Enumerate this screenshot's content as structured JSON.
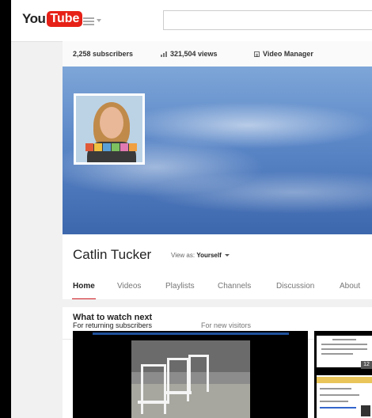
{
  "masthead": {
    "logo_you": "You",
    "logo_tube": "Tube"
  },
  "stats": {
    "subscribers": "2,258 subscribers",
    "views": "321,504 views",
    "video_manager": "Video Manager"
  },
  "channel": {
    "name": "Catlin Tucker",
    "view_as_label": "View as:",
    "view_as_value": "Yourself"
  },
  "tabs": [
    "Home",
    "Videos",
    "Playlists",
    "Channels",
    "Discussion",
    "About"
  ],
  "subtabs": [
    "For returning subscribers",
    "For new visitors"
  ],
  "section_title": "What to watch next",
  "side_video_duration": "12",
  "colors": {
    "brand_red": "#e62117",
    "active_tab_underline": "#cc181e",
    "banner_sky": "#5b87c7"
  }
}
